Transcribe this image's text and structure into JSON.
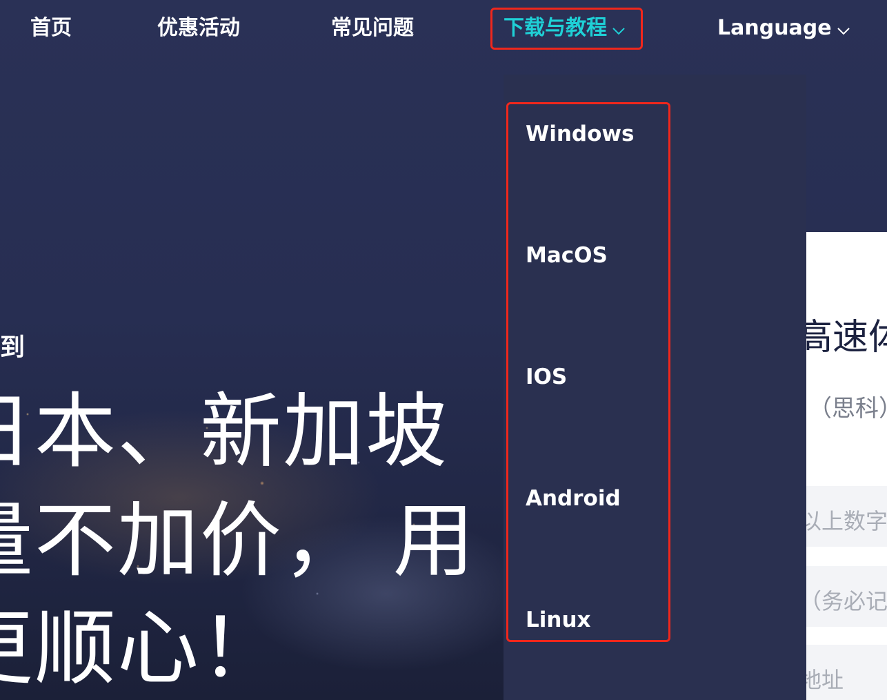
{
  "nav": {
    "home": "首页",
    "promotions": "优惠活动",
    "faq": "常见问题",
    "download": "下载与教程",
    "language": "Language"
  },
  "hero": {
    "subtitle": "到",
    "line1": "日本、新加坡",
    "line2": "量不加价， 用",
    "line3": "更顺心！"
  },
  "dropdown": {
    "items": [
      "Windows",
      "MacOS",
      "IOS",
      "Android",
      "Linux"
    ]
  },
  "panel": {
    "title": "高速体",
    "subtitle": "）（思科）",
    "field1_placeholder": "以上数字",
    "field2_placeholder": "（务必记住",
    "field3_placeholder": "地址"
  },
  "colors": {
    "active_nav": "#1fd0d6",
    "highlight": "#f0271c",
    "dropdown_bg": "#2a3050"
  }
}
